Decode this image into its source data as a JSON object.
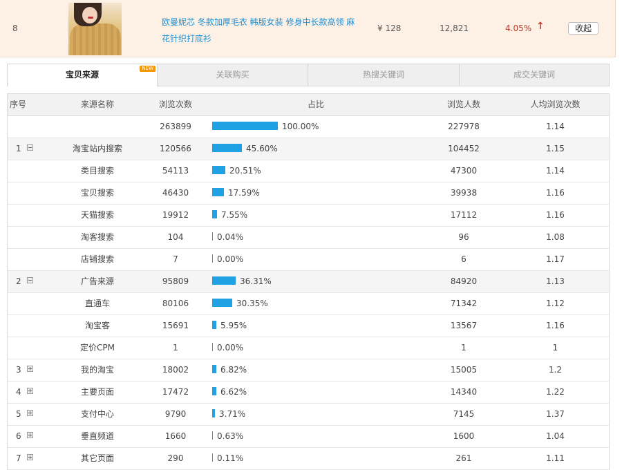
{
  "product": {
    "rank": "8",
    "title": "欧曼妮芯 冬款加厚毛衣 韩版女装 修身中长款高领 麻花针织打底衫",
    "price": "¥ 128",
    "visits": "12,821",
    "rate": "4.05%",
    "collapse_label": "收起"
  },
  "tabs": [
    {
      "label": "宝贝来源",
      "active": true,
      "badge": "NEW"
    },
    {
      "label": "关联购买",
      "active": false
    },
    {
      "label": "热搜关键词",
      "active": false
    },
    {
      "label": "成交关键词",
      "active": false
    }
  ],
  "table": {
    "headers": {
      "idx": "序号",
      "name": "来源名称",
      "pv": "浏览次数",
      "share": "占比",
      "uv": "浏览人数",
      "avg": "人均浏览次数"
    },
    "rows": [
      {
        "idx": "",
        "name": "",
        "pv": "263899",
        "pct": 100.0,
        "pct_label": "100.00%",
        "uv": "227978",
        "avg": "1.14",
        "kind": "total"
      },
      {
        "idx": "1",
        "name": "淘宝站内搜索",
        "pv": "120566",
        "pct": 45.6,
        "pct_label": "45.60%",
        "uv": "104452",
        "avg": "1.15",
        "kind": "group",
        "expander": "minus"
      },
      {
        "idx": "",
        "name": "类目搜索",
        "pv": "54113",
        "pct": 20.51,
        "pct_label": "20.51%",
        "uv": "47300",
        "avg": "1.14",
        "kind": "child"
      },
      {
        "idx": "",
        "name": "宝贝搜索",
        "pv": "46430",
        "pct": 17.59,
        "pct_label": "17.59%",
        "uv": "39938",
        "avg": "1.16",
        "kind": "child"
      },
      {
        "idx": "",
        "name": "天猫搜索",
        "pv": "19912",
        "pct": 7.55,
        "pct_label": "7.55%",
        "uv": "17112",
        "avg": "1.16",
        "kind": "child"
      },
      {
        "idx": "",
        "name": "淘客搜索",
        "pv": "104",
        "pct": 0.04,
        "pct_label": "0.04%",
        "uv": "96",
        "avg": "1.08",
        "kind": "child"
      },
      {
        "idx": "",
        "name": "店铺搜索",
        "pv": "7",
        "pct": 0.0,
        "pct_label": "0.00%",
        "uv": "6",
        "avg": "1.17",
        "kind": "child"
      },
      {
        "idx": "2",
        "name": "广告来源",
        "pv": "95809",
        "pct": 36.31,
        "pct_label": "36.31%",
        "uv": "84920",
        "avg": "1.13",
        "kind": "group",
        "expander": "minus"
      },
      {
        "idx": "",
        "name": "直通车",
        "pv": "80106",
        "pct": 30.35,
        "pct_label": "30.35%",
        "uv": "71342",
        "avg": "1.12",
        "kind": "child"
      },
      {
        "idx": "",
        "name": "淘宝客",
        "pv": "15691",
        "pct": 5.95,
        "pct_label": "5.95%",
        "uv": "13567",
        "avg": "1.16",
        "kind": "child"
      },
      {
        "idx": "",
        "name": "定价CPM",
        "pv": "1",
        "pct": 0.0,
        "pct_label": "0.00%",
        "uv": "1",
        "avg": "1",
        "kind": "child"
      },
      {
        "idx": "3",
        "name": "我的淘宝",
        "pv": "18002",
        "pct": 6.82,
        "pct_label": "6.82%",
        "uv": "15005",
        "avg": "1.2",
        "kind": "top",
        "expander": "plus"
      },
      {
        "idx": "4",
        "name": "主要页面",
        "pv": "17472",
        "pct": 6.62,
        "pct_label": "6.62%",
        "uv": "14340",
        "avg": "1.22",
        "kind": "top",
        "expander": "plus"
      },
      {
        "idx": "5",
        "name": "支付中心",
        "pv": "9790",
        "pct": 3.71,
        "pct_label": "3.71%",
        "uv": "7145",
        "avg": "1.37",
        "kind": "top",
        "expander": "plus"
      },
      {
        "idx": "6",
        "name": "垂直频道",
        "pv": "1660",
        "pct": 0.63,
        "pct_label": "0.63%",
        "uv": "1600",
        "avg": "1.04",
        "kind": "top",
        "expander": "plus"
      },
      {
        "idx": "7",
        "name": "其它页面",
        "pv": "290",
        "pct": 0.11,
        "pct_label": "0.11%",
        "uv": "261",
        "avg": "1.11",
        "kind": "top",
        "expander": "plus"
      }
    ]
  },
  "colors": {
    "bar": "#1fa1e3",
    "accent_link": "#1f8fd0",
    "rate_up": "#c0392b"
  }
}
